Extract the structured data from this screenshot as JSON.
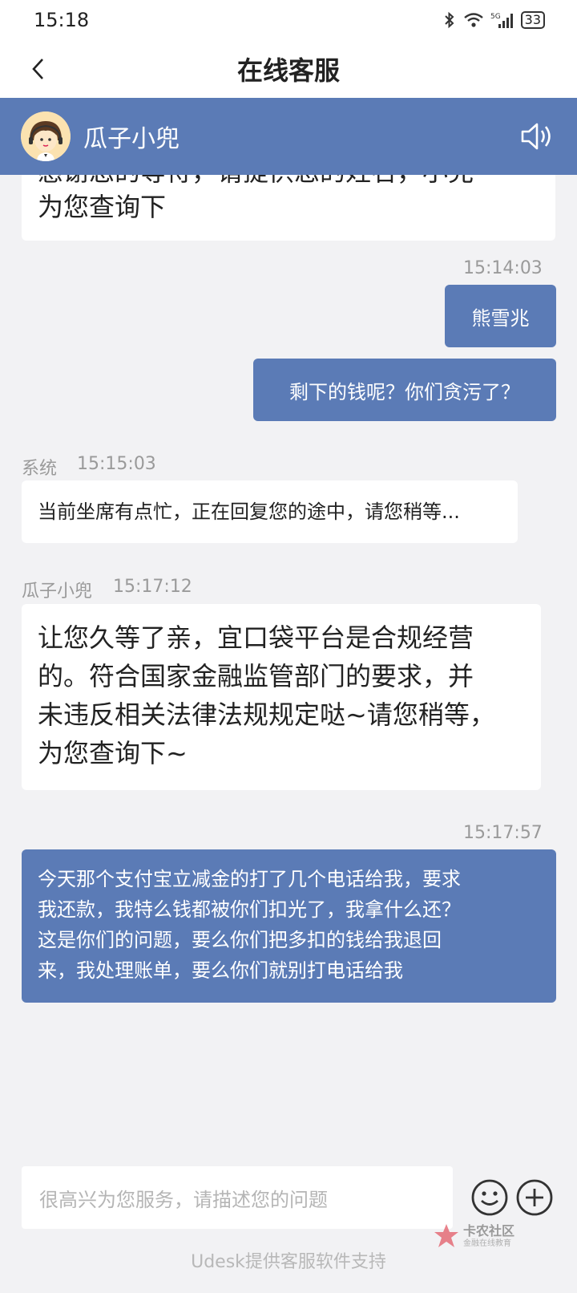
{
  "status_bar": {
    "time": "15:18",
    "network": "5G",
    "battery": "33"
  },
  "nav": {
    "title": "在线客服"
  },
  "agent": {
    "name": "瓜子小兜"
  },
  "messages": [
    {
      "from": "agent",
      "text_line1": "感谢您的等待，请提供您的姓名，小兜",
      "text_line2": "为您查询下"
    },
    {
      "from": "user",
      "time": "15:14:03",
      "text": "熊雪兆"
    },
    {
      "from": "user",
      "text": "剩下的钱呢？你们贪污了？"
    },
    {
      "from": "system",
      "sender": "系统",
      "time": "15:15:03",
      "text": "当前坐席有点忙，正在回复您的途中，请您稍等..."
    },
    {
      "from": "agent",
      "sender": "瓜子小兜",
      "time": "15:17:12",
      "lines": [
        "让您久等了亲，宜口袋平台是合规经营",
        "的。符合国家金融监管部门的要求，并",
        "未违反相关法律法规规定哒~请您稍等，",
        "为您查询下~"
      ]
    },
    {
      "from": "user",
      "time": "15:17:57",
      "lines": [
        "今天那个支付宝立减金的打了几个电话给我，要求",
        "我还款，我特么钱都被你们扣光了，我拿什么还？",
        "这是你们的问题，要么你们把多扣的钱给我退回",
        "来，我处理账单，要么你们就别打电话给我"
      ]
    }
  ],
  "input": {
    "placeholder": "很高兴为您服务，请描述您的问题"
  },
  "footer": {
    "text": "Udesk提供客服软件支持"
  },
  "watermark": {
    "main": "卡农社区",
    "sub": "金融在线教育"
  },
  "colors": {
    "accent": "#5b7bb6",
    "background": "#f2f2f4"
  }
}
